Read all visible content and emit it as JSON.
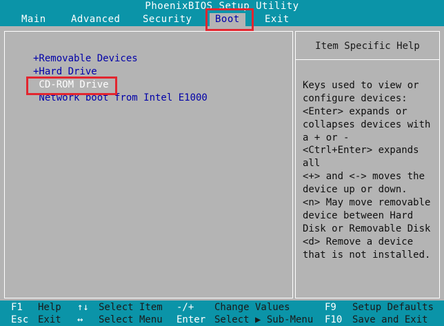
{
  "window": {
    "title": "PhoenixBIOS Setup Utility"
  },
  "menu": {
    "items": [
      "Main",
      "Advanced",
      "Security",
      "Boot",
      "Exit"
    ],
    "active_index": 3
  },
  "boot": {
    "items": [
      "+Removable Devices",
      "+Hard Drive",
      " CD-ROM Drive",
      " Network boot from Intel E1000"
    ],
    "selected_index": 2
  },
  "help": {
    "title": "Item Specific Help",
    "lines": [
      "Keys used to view or",
      "configure devices:",
      "<Enter> expands or",
      "collapses devices with",
      "a + or -",
      "<Ctrl+Enter> expands",
      "all",
      "<+> and <-> moves the",
      "device up or down.",
      "<n> May move removable",
      "device between Hard",
      "Disk or Removable Disk",
      "<d> Remove a device",
      "that is not installed."
    ]
  },
  "footer": {
    "row1": [
      {
        "key": "F1",
        "desc": "Help"
      },
      {
        "key": "↑↓",
        "desc": "Select Item"
      },
      {
        "key": "-/+",
        "desc": "Change Values"
      },
      {
        "key": "F9",
        "desc": "Setup Defaults"
      }
    ],
    "row2": [
      {
        "key": "Esc",
        "desc": "Exit"
      },
      {
        "key": "↔",
        "desc": "Select Menu"
      },
      {
        "key": "Enter",
        "desc": "Select ▶ Sub-Menu"
      },
      {
        "key": "F10",
        "desc": "Save and Exit"
      }
    ]
  },
  "colors": {
    "bar": "#0b94a8",
    "panel": "#b4b4b4",
    "highlight_box": "#e2262f",
    "item_text": "#0000a8"
  }
}
